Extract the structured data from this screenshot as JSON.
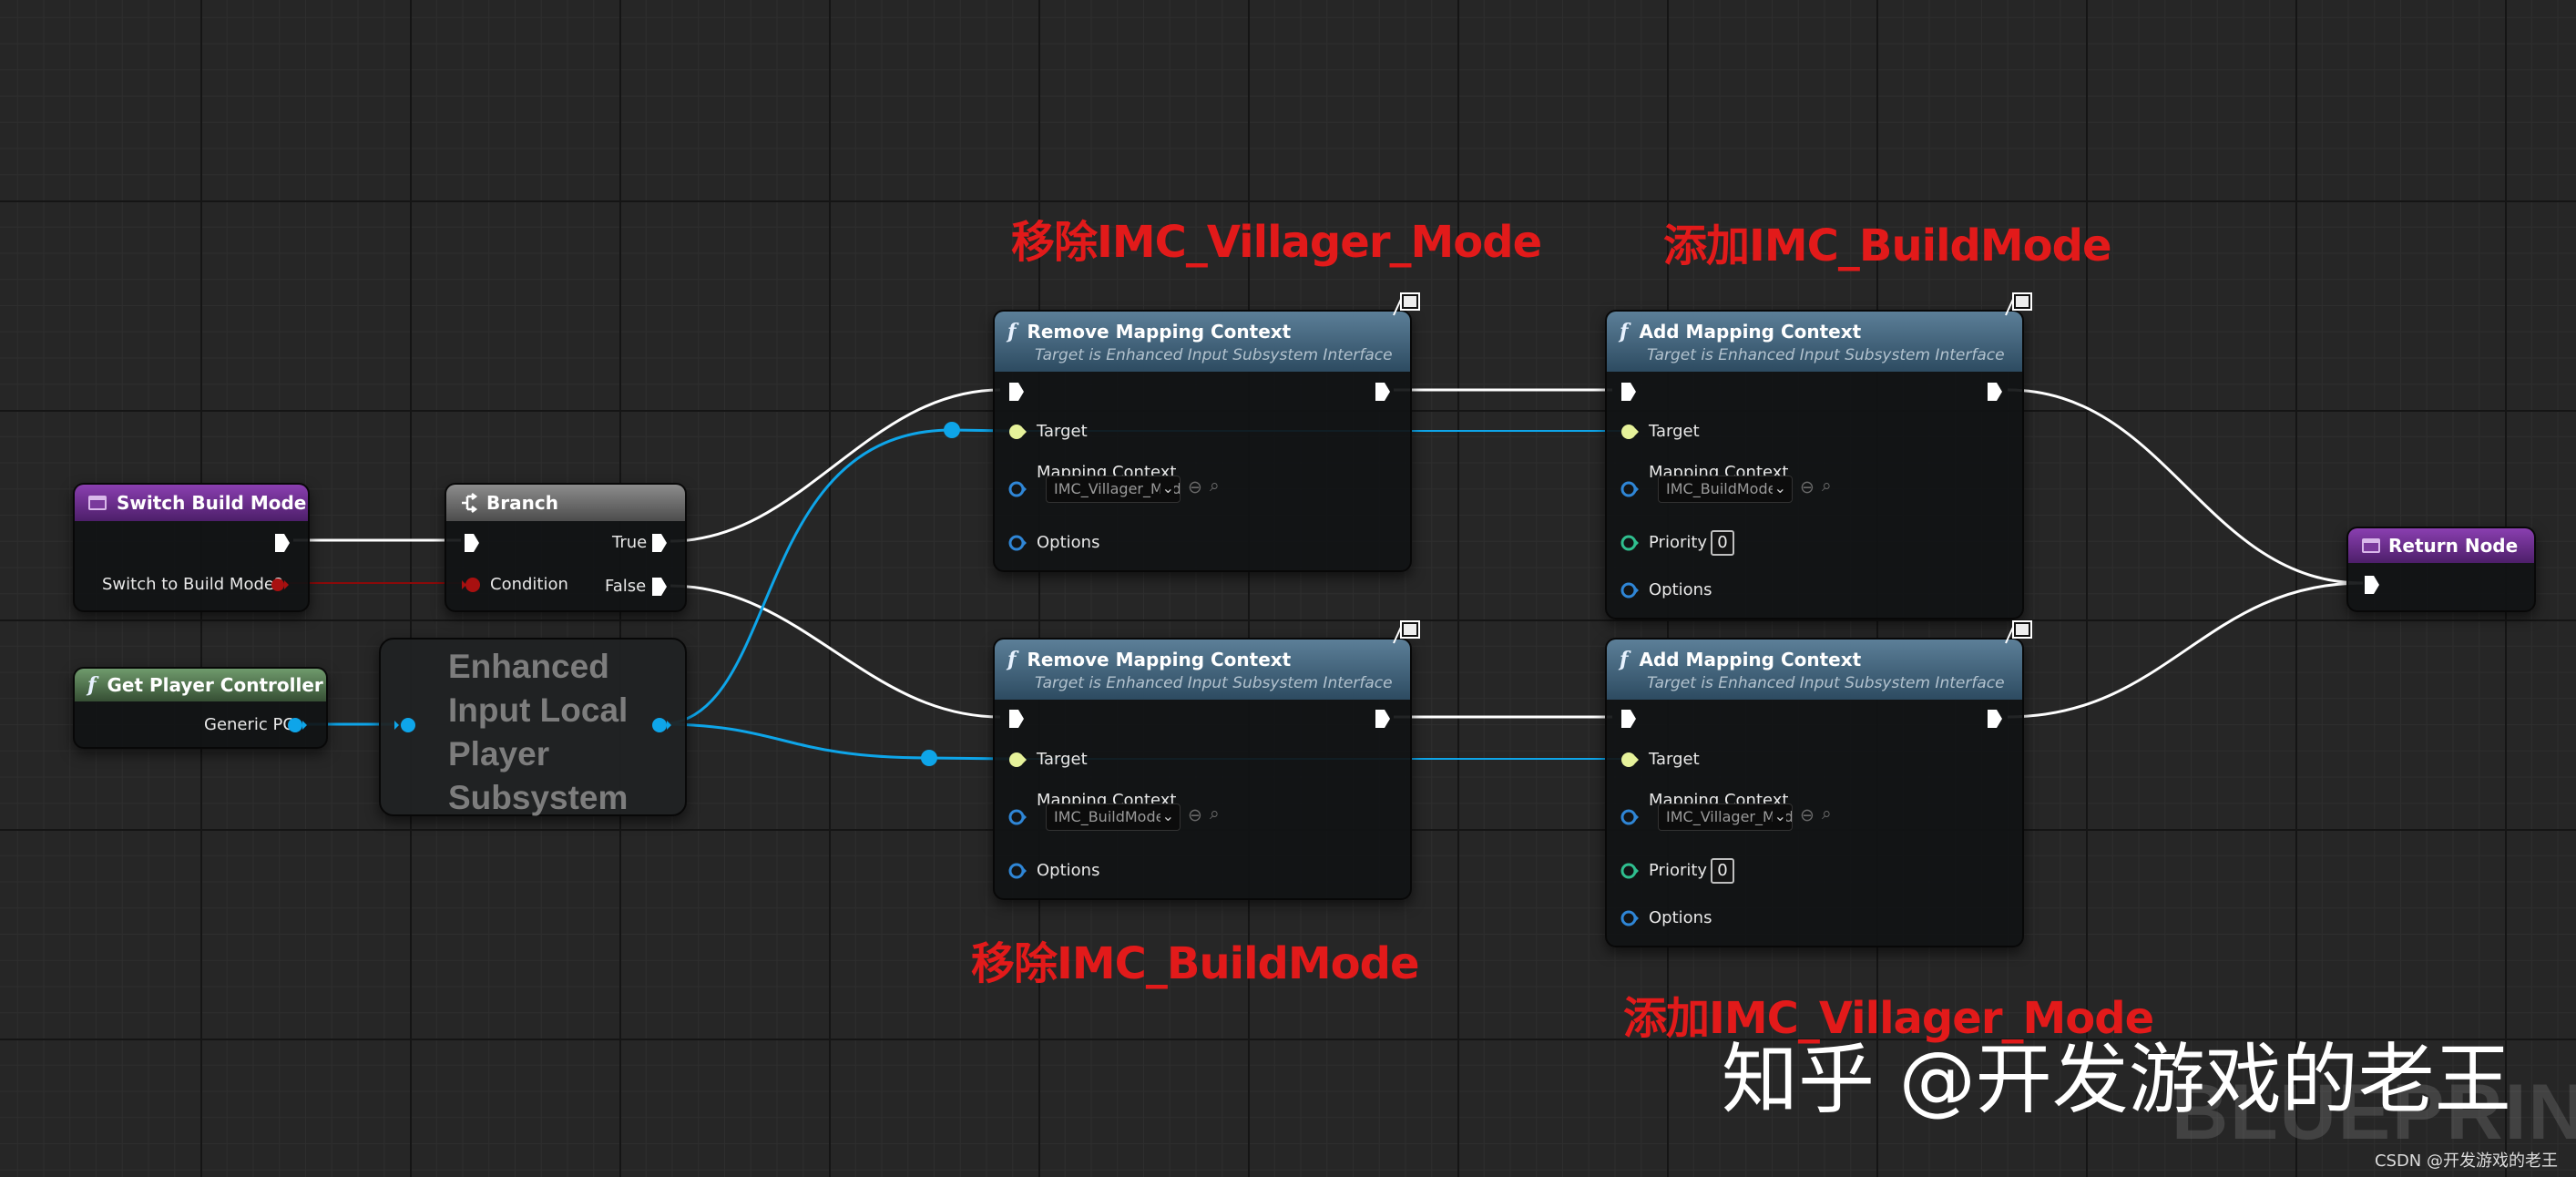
{
  "comments": {
    "remove_villager": "移除IMC_Villager_Mode",
    "add_build": "添加IMC_BuildMode",
    "remove_build": "移除IMC_BuildMode",
    "add_villager": "添加IMC_Villager_Mode"
  },
  "nodes": {
    "switch_build_mode": {
      "title": "Switch Build Mode",
      "param_label": "Switch to Build Mode?"
    },
    "branch": {
      "title": "Branch",
      "true_label": "True",
      "false_label": "False",
      "condition_label": "Condition"
    },
    "get_player_controller": {
      "title": "Get Player Controller",
      "output_label": "Generic PC"
    },
    "subsystem": {
      "title": "Enhanced Input Local Player Subsystem"
    },
    "remove_1": {
      "title": "Remove Mapping Context",
      "subtitle": "Target is Enhanced Input Subsystem Interface",
      "target_label": "Target",
      "mapping_label": "Mapping Context",
      "mapping_value": "IMC_Villager_Mode",
      "options_label": "Options"
    },
    "add_1": {
      "title": "Add Mapping Context",
      "subtitle": "Target is Enhanced Input Subsystem Interface",
      "target_label": "Target",
      "mapping_label": "Mapping Context",
      "mapping_value": "IMC_BuildMode",
      "priority_label": "Priority",
      "priority_value": "0",
      "options_label": "Options"
    },
    "remove_2": {
      "title": "Remove Mapping Context",
      "subtitle": "Target is Enhanced Input Subsystem Interface",
      "target_label": "Target",
      "mapping_label": "Mapping Context",
      "mapping_value": "IMC_BuildMode",
      "options_label": "Options"
    },
    "add_2": {
      "title": "Add Mapping Context",
      "subtitle": "Target is Enhanced Input Subsystem Interface",
      "target_label": "Target",
      "mapping_label": "Mapping Context",
      "mapping_value": "IMC_Villager_Mode",
      "priority_label": "Priority",
      "priority_value": "0",
      "options_label": "Options"
    },
    "return_node": {
      "title": "Return Node"
    }
  },
  "watermark": "知乎 @开发游戏的老王",
  "blueprint_mark": "BLUEPRINT",
  "credit": "CSDN @开发游戏的老王",
  "colors": {
    "exec_wire": "#ffffff",
    "object_wire": "#0ea5e9",
    "bool_pin": "#8b0a0a",
    "target_pin": "#e6f29a",
    "priority_pin": "#2fbf8f",
    "options_pin": "#2f86d6",
    "comment_text": "#e21a1a"
  },
  "icons": [
    "function-icon",
    "branch-icon",
    "event-icon",
    "network-icon",
    "browse-icon",
    "search-icon",
    "chevron-down-icon"
  ]
}
